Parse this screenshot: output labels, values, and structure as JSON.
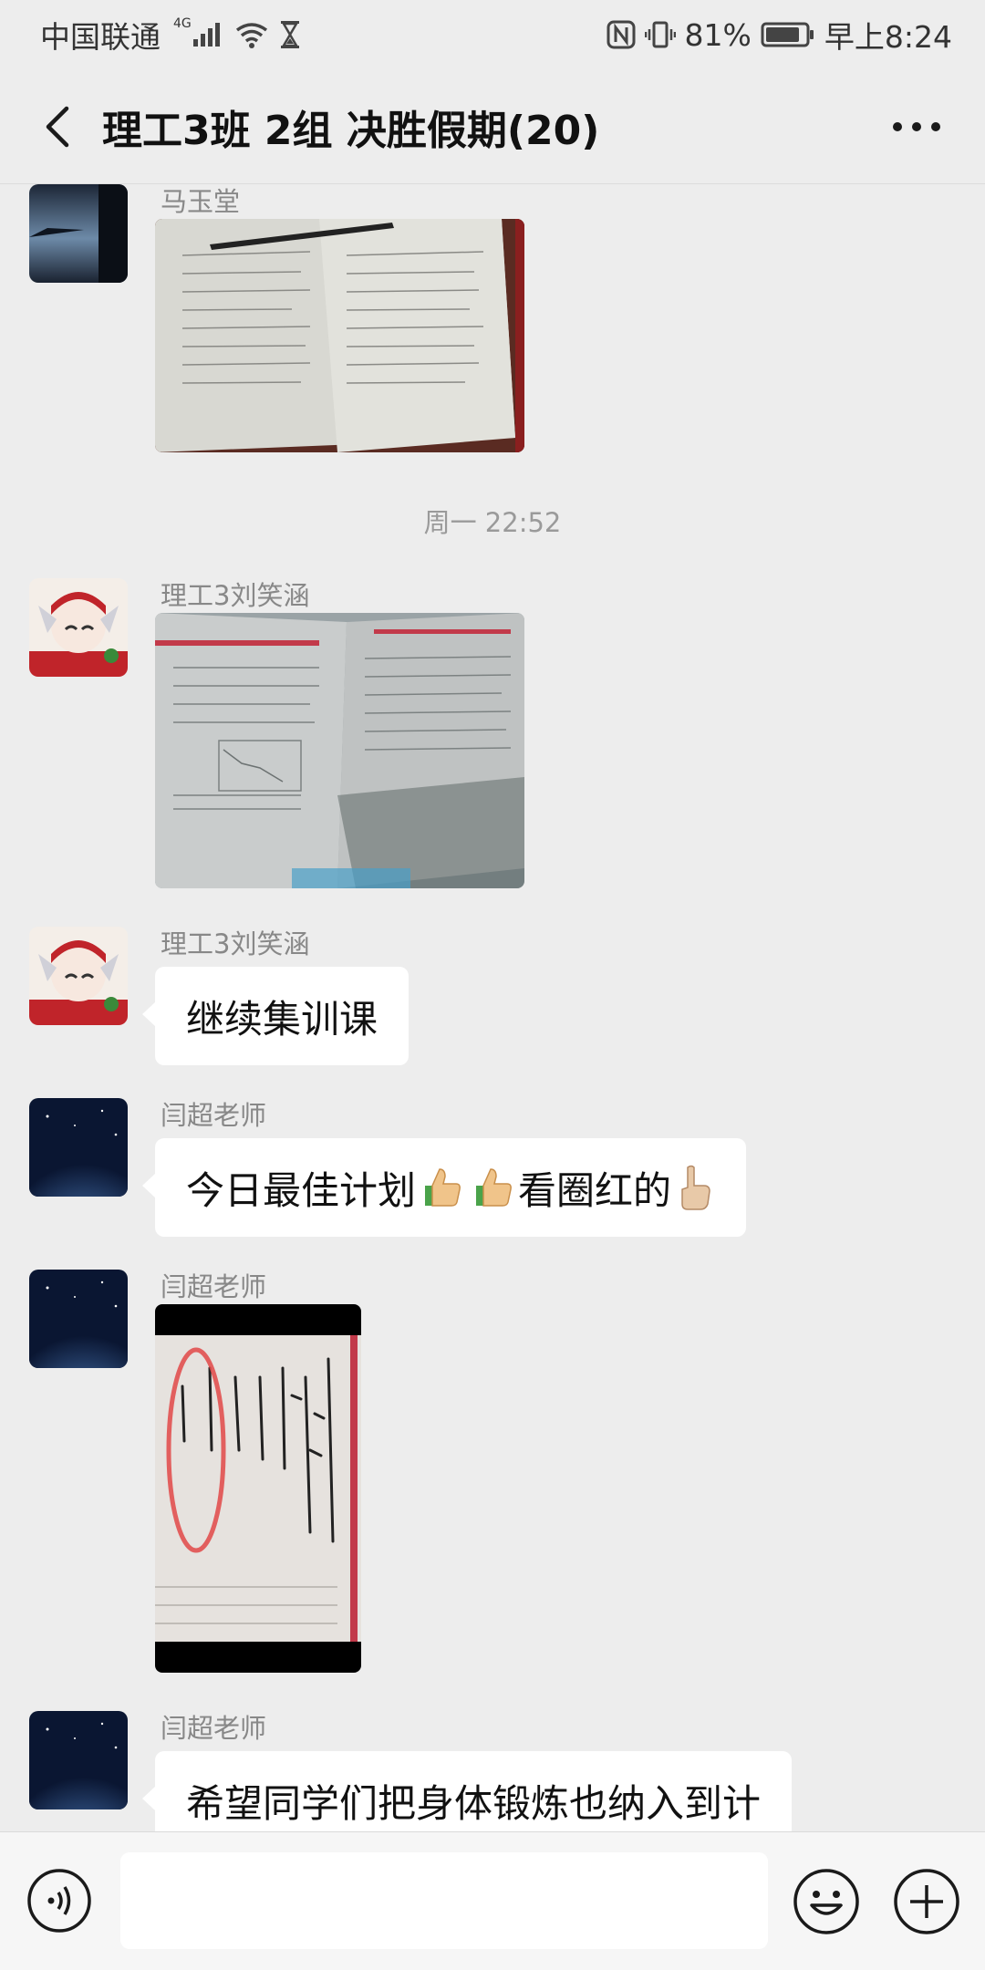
{
  "status_bar": {
    "carrier": "中国联通",
    "network": "4G",
    "battery": "81%",
    "time": "早上8:24",
    "icons": [
      "signal-icon",
      "wifi-icon",
      "hourglass-icon",
      "nfc-icon",
      "vibrate-icon",
      "battery-icon"
    ]
  },
  "header": {
    "title": "理工3班 2组 决胜假期(20)",
    "back_icon": "chevron-left-icon",
    "more_icon": "more-dots-icon"
  },
  "messages": [
    {
      "sender": "马玉堂",
      "type": "image",
      "image_desc": "photo-of-worksheet-with-pen"
    },
    {
      "divider": "周一 22:52"
    },
    {
      "sender": "理工3刘笑涵",
      "type": "image",
      "image_desc": "photo-of-open-exam-booklet"
    },
    {
      "sender": "理工3刘笑涵",
      "type": "text",
      "text": "继续集训课"
    },
    {
      "sender": "闫超老师",
      "type": "text",
      "text_parts": [
        "今日最佳计划",
        "看圈红的"
      ],
      "emojis": [
        "thumbs-up-icon",
        "thumbs-up-icon",
        "point-up-icon"
      ]
    },
    {
      "sender": "闫超老师",
      "type": "image",
      "image_desc": "photo-of-handwritten-note-with-red-circle"
    },
    {
      "sender": "闫超老师",
      "type": "text",
      "text": "希望同学们把身体锻炼也纳入到计"
    }
  ],
  "input_bar": {
    "icons": [
      "voice-icon",
      "emoji-icon",
      "plus-icon"
    ]
  }
}
